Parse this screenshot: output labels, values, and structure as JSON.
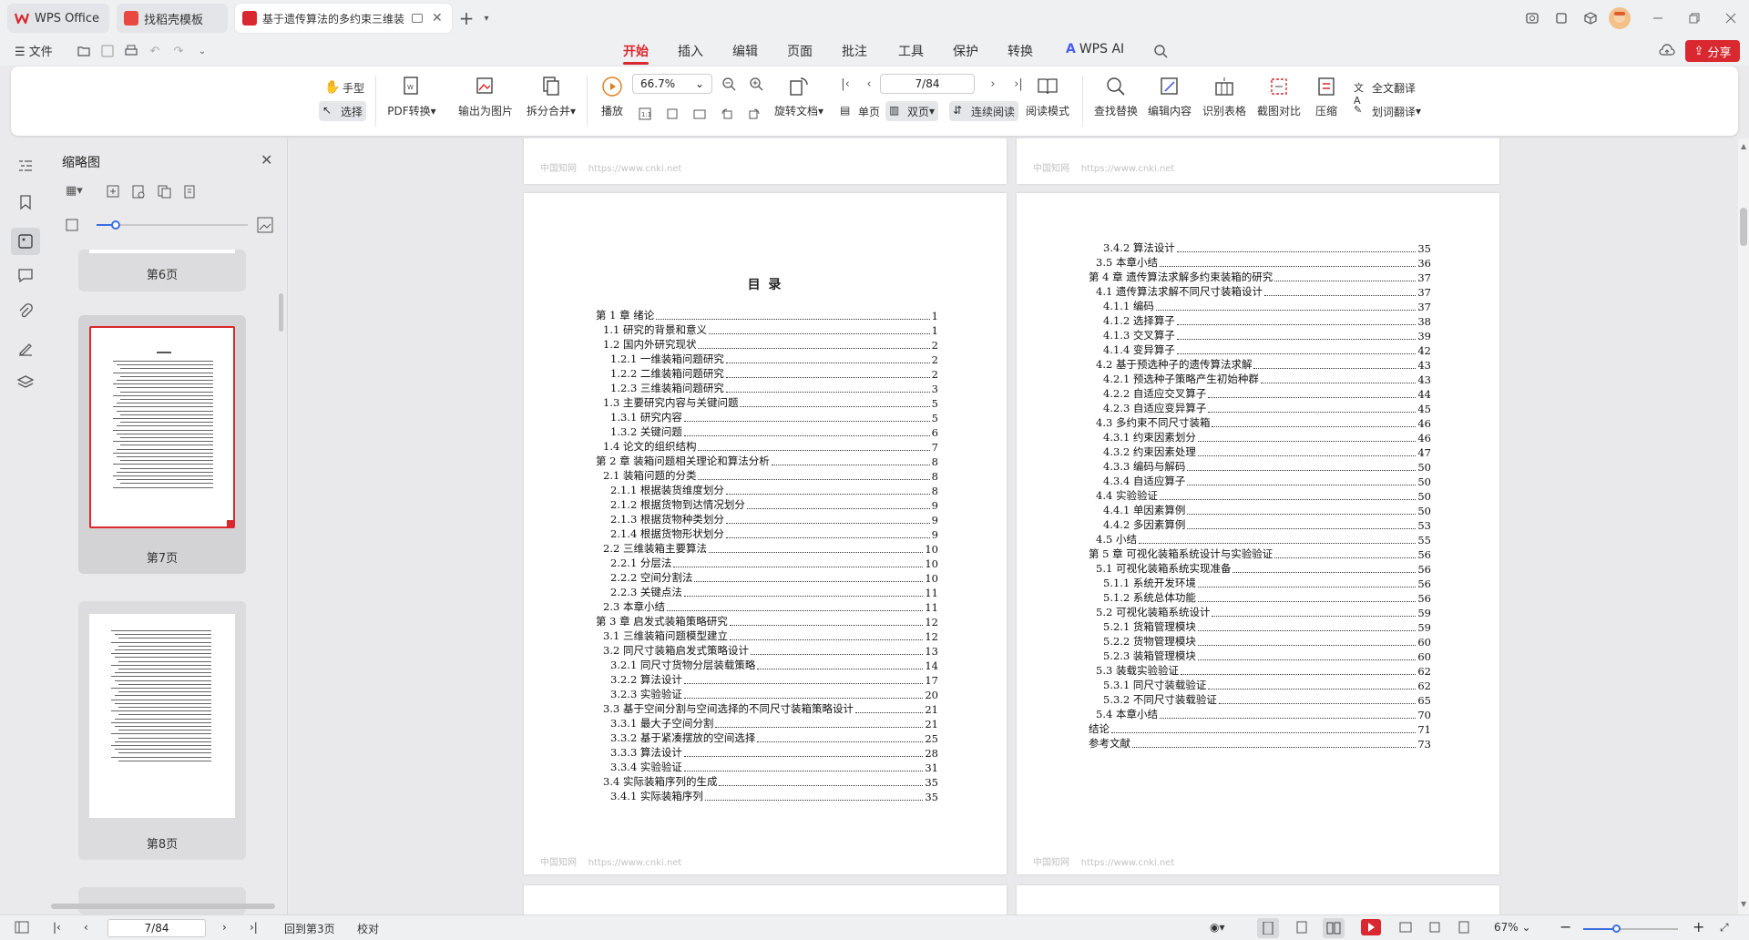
{
  "tabs": [
    {
      "label": "WPS Office"
    },
    {
      "label": "找稻壳模板"
    },
    {
      "label": "基于遗传算法的多约束三维装"
    }
  ],
  "menu": {
    "file": "文件",
    "items": [
      "开始",
      "插入",
      "编辑",
      "页面",
      "批注",
      "工具",
      "保护",
      "转换"
    ],
    "ai": "WPS AI",
    "share": "分享"
  },
  "ribbon": {
    "hand": "手型",
    "select": "选择",
    "pdf_convert": "PDF转换",
    "export_image": "输出为图片",
    "split_merge": "拆分合并",
    "play": "播放",
    "zoom": "66.7%",
    "rotate": "旋转文档",
    "page_input": "7/84",
    "single": "单页",
    "double": "双页",
    "continuous": "连续阅读",
    "read_mode": "阅读模式",
    "find_replace": "查找替换",
    "edit_content": "编辑内容",
    "recognize_table": "识别表格",
    "screenshot_compare": "截图对比",
    "compress": "压缩",
    "full_translate": "全文翻译",
    "word_translate": "划词翻译"
  },
  "thumbs": {
    "title": "缩略图",
    "page6": "第6页",
    "page7": "第7页",
    "page8": "第8页"
  },
  "doc": {
    "watermark": "中国知网",
    "watermark_url": "https://www.cnki.net",
    "toc_title": "目  录",
    "left": [
      {
        "t": "第 1 章  绪论",
        "p": "1",
        "lv": 0
      },
      {
        "t": "1.1  研究的背景和意义",
        "p": "1",
        "lv": 1
      },
      {
        "t": "1.2  国内外研究现状",
        "p": "2",
        "lv": 1
      },
      {
        "t": "1.2.1  一维装箱问题研究",
        "p": "2",
        "lv": 2
      },
      {
        "t": "1.2.2  二维装箱问题研究",
        "p": "2",
        "lv": 2
      },
      {
        "t": "1.2.3  三维装箱问题研究",
        "p": "3",
        "lv": 2
      },
      {
        "t": "1.3  主要研究内容与关键问题",
        "p": "5",
        "lv": 1
      },
      {
        "t": "1.3.1  研究内容",
        "p": "5",
        "lv": 2
      },
      {
        "t": "1.3.2  关键问题",
        "p": "6",
        "lv": 2
      },
      {
        "t": "1.4  论文的组织结构",
        "p": "7",
        "lv": 1
      },
      {
        "t": "第 2 章  装箱问题相关理论和算法分析",
        "p": "8",
        "lv": 0
      },
      {
        "t": "2.1  装箱问题的分类",
        "p": "8",
        "lv": 1
      },
      {
        "t": "2.1.1  根据装货维度划分",
        "p": "8",
        "lv": 2
      },
      {
        "t": "2.1.2  根据货物到达情况划分",
        "p": "9",
        "lv": 2
      },
      {
        "t": "2.1.3  根据货物种类划分",
        "p": "9",
        "lv": 2
      },
      {
        "t": "2.1.4  根据货物形状划分",
        "p": "9",
        "lv": 2
      },
      {
        "t": "2.2  三维装箱主要算法",
        "p": "10",
        "lv": 1
      },
      {
        "t": "2.2.1  分层法",
        "p": "10",
        "lv": 2
      },
      {
        "t": "2.2.2  空间分割法",
        "p": "10",
        "lv": 2
      },
      {
        "t": "2.2.3  关键点法",
        "p": "11",
        "lv": 2
      },
      {
        "t": "2.3  本章小结",
        "p": "11",
        "lv": 1
      },
      {
        "t": "第 3 章  启发式装箱策略研究",
        "p": "12",
        "lv": 0
      },
      {
        "t": "3.1  三维装箱问题模型建立",
        "p": "12",
        "lv": 1
      },
      {
        "t": "3.2  同尺寸装箱启发式策略设计",
        "p": "13",
        "lv": 1
      },
      {
        "t": "3.2.1  同尺寸货物分层装载策略",
        "p": "14",
        "lv": 2
      },
      {
        "t": "3.2.2  算法设计",
        "p": "17",
        "lv": 2
      },
      {
        "t": "3.2.3  实验验证",
        "p": "20",
        "lv": 2
      },
      {
        "t": "3.3  基于空间分割与空间选择的不同尺寸装箱策略设计",
        "p": "21",
        "lv": 1
      },
      {
        "t": "3.3.1  最大子空间分割",
        "p": "21",
        "lv": 2
      },
      {
        "t": "3.3.2  基于紧凑摆放的空间选择",
        "p": "25",
        "lv": 2
      },
      {
        "t": "3.3.3  算法设计",
        "p": "28",
        "lv": 2
      },
      {
        "t": "3.3.4  实验验证",
        "p": "31",
        "lv": 2
      },
      {
        "t": "3.4  实际装箱序列的生成",
        "p": "35",
        "lv": 1
      },
      {
        "t": "3.4.1  实际装箱序列",
        "p": "35",
        "lv": 2
      }
    ],
    "right": [
      {
        "t": "3.4.2  算法设计",
        "p": "35",
        "lv": 2
      },
      {
        "t": "3.5  本章小结",
        "p": "36",
        "lv": 1
      },
      {
        "t": "第 4 章  遗传算法求解多约束装箱的研究",
        "p": "37",
        "lv": 0
      },
      {
        "t": "4.1  遗传算法求解不同尺寸装箱设计",
        "p": "37",
        "lv": 1
      },
      {
        "t": "4.1.1  编码",
        "p": "37",
        "lv": 2
      },
      {
        "t": "4.1.2  选择算子",
        "p": "38",
        "lv": 2
      },
      {
        "t": "4.1.3  交叉算子",
        "p": "39",
        "lv": 2
      },
      {
        "t": "4.1.4  变异算子",
        "p": "42",
        "lv": 2
      },
      {
        "t": "4.2  基于预选种子的遗传算法求解",
        "p": "43",
        "lv": 1
      },
      {
        "t": "4.2.1  预选种子策略产生初始种群",
        "p": "43",
        "lv": 2
      },
      {
        "t": "4.2.2  自适应交叉算子",
        "p": "44",
        "lv": 2
      },
      {
        "t": "4.2.3  自适应变异算子",
        "p": "45",
        "lv": 2
      },
      {
        "t": "4.3  多约束不同尺寸装箱",
        "p": "46",
        "lv": 1
      },
      {
        "t": "4.3.1  约束因素划分",
        "p": "46",
        "lv": 2
      },
      {
        "t": "4.3.2  约束因素处理",
        "p": "47",
        "lv": 2
      },
      {
        "t": "4.3.3  编码与解码",
        "p": "50",
        "lv": 2
      },
      {
        "t": "4.3.4  自适应算子",
        "p": "50",
        "lv": 2
      },
      {
        "t": "4.4  实验验证",
        "p": "50",
        "lv": 1
      },
      {
        "t": "4.4.1  单因素算例",
        "p": "50",
        "lv": 2
      },
      {
        "t": "4.4.2  多因素算例",
        "p": "53",
        "lv": 2
      },
      {
        "t": "4.5  小结",
        "p": "55",
        "lv": 1
      },
      {
        "t": "第 5 章  可视化装箱系统设计与实验验证",
        "p": "56",
        "lv": 0
      },
      {
        "t": "5.1  可视化装箱系统实现准备",
        "p": "56",
        "lv": 1
      },
      {
        "t": "5.1.1  系统开发环境",
        "p": "56",
        "lv": 2
      },
      {
        "t": "5.1.2  系统总体功能",
        "p": "56",
        "lv": 2
      },
      {
        "t": "5.2  可视化装箱系统设计",
        "p": "59",
        "lv": 1
      },
      {
        "t": "5.2.1  货箱管理模块",
        "p": "59",
        "lv": 2
      },
      {
        "t": "5.2.2  货物管理模块",
        "p": "60",
        "lv": 2
      },
      {
        "t": "5.2.3  装箱管理模块",
        "p": "60",
        "lv": 2
      },
      {
        "t": "5.3  装载实验验证",
        "p": "62",
        "lv": 1
      },
      {
        "t": "5.3.1  同尺寸装载验证",
        "p": "62",
        "lv": 2
      },
      {
        "t": "5.3.2  不同尺寸装载验证",
        "p": "65",
        "lv": 2
      },
      {
        "t": "5.4  本章小结",
        "p": "70",
        "lv": 1
      },
      {
        "t": "结论",
        "p": "71",
        "lv": 0
      },
      {
        "t": "参考文献",
        "p": "73",
        "lv": 0
      }
    ]
  },
  "status": {
    "page_input": "7/84",
    "back_to": "回到第3页",
    "proofread": "校对",
    "zoom": "67%"
  }
}
